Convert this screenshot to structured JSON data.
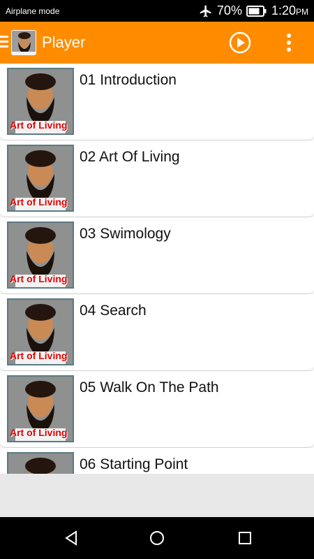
{
  "status_bar": {
    "mode": "Airplane mode",
    "battery_pct": "70%",
    "time": "1:20",
    "ampm": "PM"
  },
  "app_bar": {
    "title": "Player"
  },
  "list": {
    "thumb_label": "Art of Living",
    "items": [
      {
        "title": "01 Introduction"
      },
      {
        "title": "02 Art Of Living"
      },
      {
        "title": "03 Swimology"
      },
      {
        "title": "04 Search"
      },
      {
        "title": "05 Walk On The Path"
      },
      {
        "title": "06 Starting Point"
      }
    ]
  },
  "colors": {
    "app_bar": "#ff8c00",
    "status_bar": "#000000",
    "thumb_label": "#e00000"
  },
  "icons": [
    "airplane-icon",
    "battery-icon",
    "menu-icon",
    "play-icon",
    "more-vert-icon",
    "back-icon",
    "home-icon",
    "recents-icon"
  ]
}
